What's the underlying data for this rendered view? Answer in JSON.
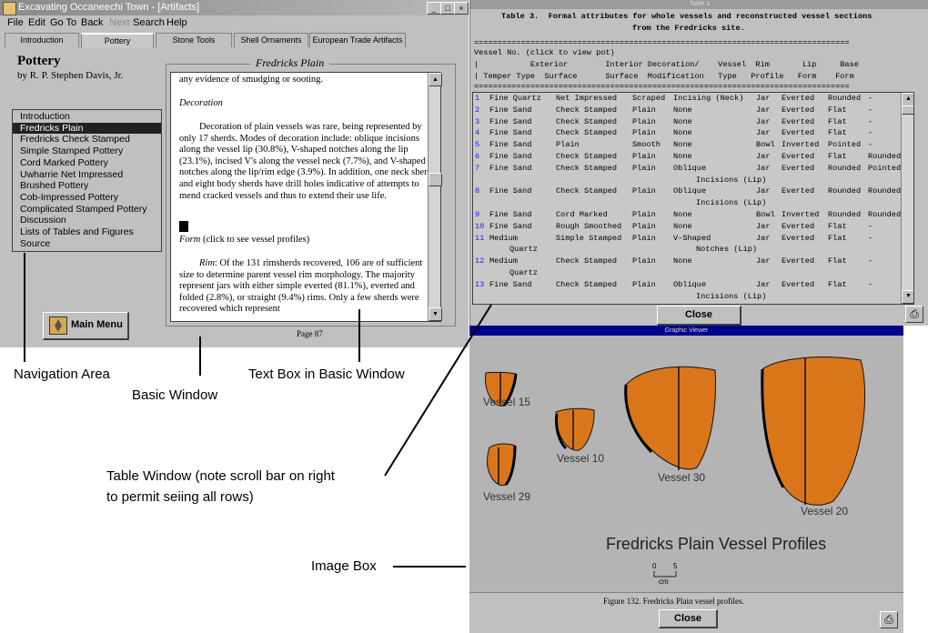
{
  "app": {
    "title": "Excavating Occaneechi Town - [Artifacts]",
    "menu": [
      "File",
      "Edit",
      "Go To",
      "Back",
      "Next",
      "Search",
      "Help"
    ],
    "tabs": [
      "Introduction",
      "Pottery",
      "Stone Tools",
      "Shell Ornaments",
      "European Trade Artifacts"
    ],
    "active_tab": "Pottery",
    "heading": "Pottery",
    "author": "by R. P. Stephen Davis, Jr.",
    "nav_items": [
      "Introduction",
      "Fredricks Plain",
      "Fredricks Check Stamped",
      "Simple Stamped Pottery",
      "Cord Marked Pottery",
      "Uwharrie Net Impressed",
      "Brushed Pottery",
      "Cob-Impressed Pottery",
      "Complicated Stamped Pottery",
      "Discussion",
      "Lists of Tables and Figures",
      "Source"
    ],
    "selected_nav": "Fredricks Plain",
    "main_menu_label": "Main Menu",
    "frame_title": "Fredricks Plain",
    "page_label": "Page 87",
    "text": {
      "p1": "any evidence of smudging or sooting.",
      "decoration_heading": "Decoration",
      "p2": "Decoration of plain vessels was rare, being represented by only 17 sherds.  Modes of decoration include: oblique incisions along the vessel lip (30.8%), V-shaped notches along the lip (23.1%), incised V's along the vessel neck (7.7%), and V-shaped notches along the lip/rim edge (3.9%).  In addition, one neck sherd and eight body sherds have drill holes indicative of attempts to mend cracked vessels and thus to extend their use life.",
      "form_heading": "Form",
      "form_link": "(click to see vessel profiles)",
      "rim_label": "Rim",
      "p3": ": Of the 131 rimsherds recovered, 106 are of sufficient size to determine parent vessel rim morphology.  The majority represent jars with either simple everted (81.1%), everted and folded (2.8%), or straight (9.4%) rims.  Only a few sherds were recovered which represent"
    }
  },
  "table_window": {
    "title": "Table 3",
    "caption_line1": "Table 3.  Formal attributes for whole vessels and reconstructed vessel sections",
    "caption_line2": "from the Fredricks site.",
    "separator": "================================================================================",
    "header_line1": "Vessel No. (click to view pot)",
    "header_line2": "|           Exterior        Interior Decoration/    Vessel  Rim       Lip     Base",
    "header_line3": "| Temper Type  Surface      Surface  Modification   Type   Profile   Form    Form",
    "rows": [
      {
        "no": "1",
        "temper": "Fine Quartz",
        "ext": "Net Impressed",
        "int": "Scraped",
        "dec": "Incising (Neck)",
        "dec2": "",
        "type": "Jar",
        "rim": "Everted",
        "lip": "Rounded",
        "base": "-",
        "temper2": ""
      },
      {
        "no": "2",
        "temper": "Fine Sand",
        "ext": "Check Stamped",
        "int": "Plain",
        "dec": "None",
        "dec2": "",
        "type": "Jar",
        "rim": "Everted",
        "lip": "Flat",
        "base": "-",
        "temper2": ""
      },
      {
        "no": "3",
        "temper": "Fine Sand",
        "ext": "Check Stamped",
        "int": "Plain",
        "dec": "None",
        "dec2": "",
        "type": "Jar",
        "rim": "Everted",
        "lip": "Flat",
        "base": "-",
        "temper2": ""
      },
      {
        "no": "4",
        "temper": "Fine Sand",
        "ext": "Check Stamped",
        "int": "Plain",
        "dec": "None",
        "dec2": "",
        "type": "Jar",
        "rim": "Everted",
        "lip": "Flat",
        "base": "-",
        "temper2": ""
      },
      {
        "no": "5",
        "temper": "Fine Sand",
        "ext": "Plain",
        "int": "Smooth",
        "dec": "None",
        "dec2": "",
        "type": "Bowl",
        "rim": "Inverted",
        "lip": "Pointed",
        "base": "-",
        "temper2": ""
      },
      {
        "no": "6",
        "temper": "Fine Sand",
        "ext": "Check Stamped",
        "int": "Plain",
        "dec": "None",
        "dec2": "",
        "type": "Jar",
        "rim": "Everted",
        "lip": "Flat",
        "base": "Rounded",
        "temper2": ""
      },
      {
        "no": "7",
        "temper": "Fine Sand",
        "ext": "Check Stamped",
        "int": "Plain",
        "dec": "Oblique",
        "dec2": "Incisions (Lip)",
        "type": "Jar",
        "rim": "Everted",
        "lip": "Rounded",
        "base": "Pointed",
        "temper2": ""
      },
      {
        "no": "8",
        "temper": "Fine Sand",
        "ext": "Check Stamped",
        "int": "Plain",
        "dec": "Oblique",
        "dec2": "Incisions (Lip)",
        "type": "Jar",
        "rim": "Everted",
        "lip": "Rounded",
        "base": "Rounded",
        "temper2": ""
      },
      {
        "no": "9",
        "temper": "Fine Sand",
        "ext": "Cord Marked",
        "int": "Plain",
        "dec": "None",
        "dec2": "",
        "type": "Bowl",
        "rim": "Inverted",
        "lip": "Rounded",
        "base": "Rounded",
        "temper2": ""
      },
      {
        "no": "10",
        "temper": "Fine Sand",
        "ext": "Rough Smoothed",
        "int": "Plain",
        "dec": "None",
        "dec2": "",
        "type": "Jar",
        "rim": "Everted",
        "lip": "Flat",
        "base": "-",
        "temper2": ""
      },
      {
        "no": "11",
        "temper": "Medium",
        "ext": "Simple Stamped",
        "int": "Plain",
        "dec": "V-Shaped",
        "dec2": "Notches (Lip)",
        "type": "Jar",
        "rim": "Everted",
        "lip": "Flat",
        "base": "-",
        "temper2": "Quartz"
      },
      {
        "no": "12",
        "temper": "Medium",
        "ext": "Check Stamped",
        "int": "Plain",
        "dec": "None",
        "dec2": "",
        "type": "Jar",
        "rim": "Everted",
        "lip": "Flat",
        "base": "-",
        "temper2": "Quartz"
      },
      {
        "no": "13",
        "temper": "Fine Sand",
        "ext": "Check Stamped",
        "int": "Plain",
        "dec": "Oblique",
        "dec2": "Incisions (Lip)",
        "type": "Jar",
        "rim": "Everted",
        "lip": "Flat",
        "base": "-",
        "temper2": ""
      }
    ],
    "close_label": "Close"
  },
  "graphic_viewer": {
    "title": "Graphic Viewer",
    "vessel_labels": [
      "Vessel 15",
      "Vessel 29",
      "Vessel 10",
      "Vessel 30",
      "Vessel 20"
    ],
    "caption": "Fredricks Plain Vessel Profiles",
    "scale_min": "0",
    "scale_max": "5",
    "scale_unit": "cm",
    "figure_caption": "Figure 132.  Fredricks Plain vessel profiles.",
    "close_label": "Close",
    "vessel_color": "#d9761a"
  },
  "annotations": {
    "nav_area": "Navigation Area",
    "basic_window": "Basic Window",
    "text_box": "Text Box in Basic Window",
    "table_window_line1": "Table Window (note scroll bar on right",
    "table_window_line2": "to permit seiing all rows)",
    "image_box": "Image Box"
  }
}
